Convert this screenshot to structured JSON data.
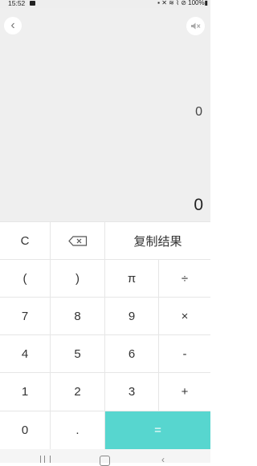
{
  "status_bar": {
    "time": "15:52",
    "battery": "100%"
  },
  "display": {
    "expression": "0",
    "result": "0",
    "back_icon": "chevron-left-icon",
    "sound_icon": "speaker-muted-icon"
  },
  "keys": {
    "clear": "C",
    "backspace_icon": "backspace-icon",
    "copy_result": "复制结果",
    "open_paren": "(",
    "close_paren": ")",
    "pi": "π",
    "divide": "÷",
    "seven": "7",
    "eight": "8",
    "nine": "9",
    "multiply": "×",
    "four": "4",
    "five": "5",
    "six": "6",
    "minus": "-",
    "one": "1",
    "two": "2",
    "three": "3",
    "plus": "+",
    "zero": "0",
    "decimal": ".",
    "equals": "="
  },
  "colors": {
    "equals_bg": "#57d6cf",
    "display_bg": "#efefef"
  }
}
